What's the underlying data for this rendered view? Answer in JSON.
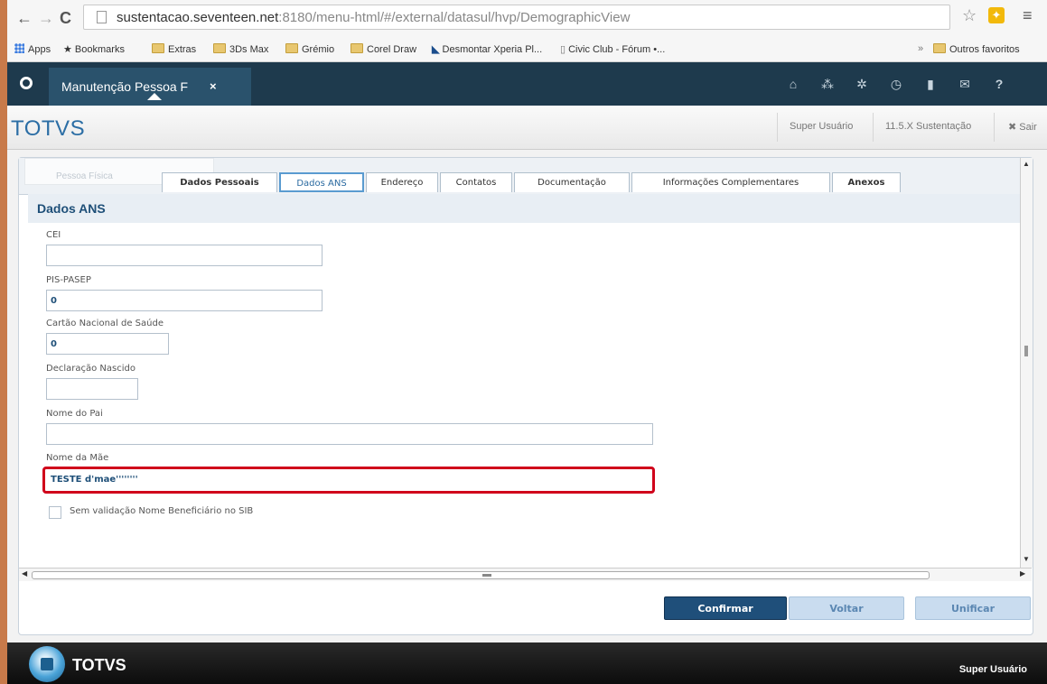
{
  "browser": {
    "url_host": "sustentacao.seventeen.net",
    "url_rest": ":8180/menu-html/#/external/datasul/hvp/DemographicView",
    "bookmarks": [
      "Apps",
      "Bookmarks",
      "Extras",
      "3Ds Max",
      "Grémio",
      "Corel Draw",
      "Desmontar Xperia Pl...",
      "Civic Club - Fórum •...",
      "»",
      "Outros favoritos"
    ]
  },
  "app": {
    "tab_title": "Manutenção Pessoa F",
    "tab_close": "×",
    "brand": "TOTVS",
    "header_links": [
      "Super Usuário",
      "11.5.X Sustentação",
      "✖ Sair"
    ]
  },
  "form": {
    "faded_tab": "Pessoa Física",
    "tabs": [
      "Dados Pessoais",
      "Dados ANS",
      "Endereço",
      "Contatos",
      "Documentação",
      "Informações Complementares",
      "Anexos"
    ],
    "selected_tab": "Dados ANS",
    "section_title": "Dados ANS",
    "fields": [
      {
        "label": "CEI",
        "value": ""
      },
      {
        "label": "PIS-PASEP",
        "value": "0"
      },
      {
        "label": "Cartão Nacional de Saúde",
        "value": "0"
      },
      {
        "label": "Declaração Nascido",
        "value": ""
      },
      {
        "label": "Nome do Pai",
        "value": ""
      },
      {
        "label": "Nome da Mãe",
        "value": "TESTE d'mae''''''''"
      }
    ],
    "checkbox_label": "Sem validação Nome Beneficiário no SIB",
    "checkbox_checked": false
  },
  "buttons": {
    "confirm": "Confirmar",
    "back": "Voltar",
    "unify": "Unificar"
  },
  "taskbar": {
    "brand": "TOTVS",
    "user": "Super Usuário"
  }
}
